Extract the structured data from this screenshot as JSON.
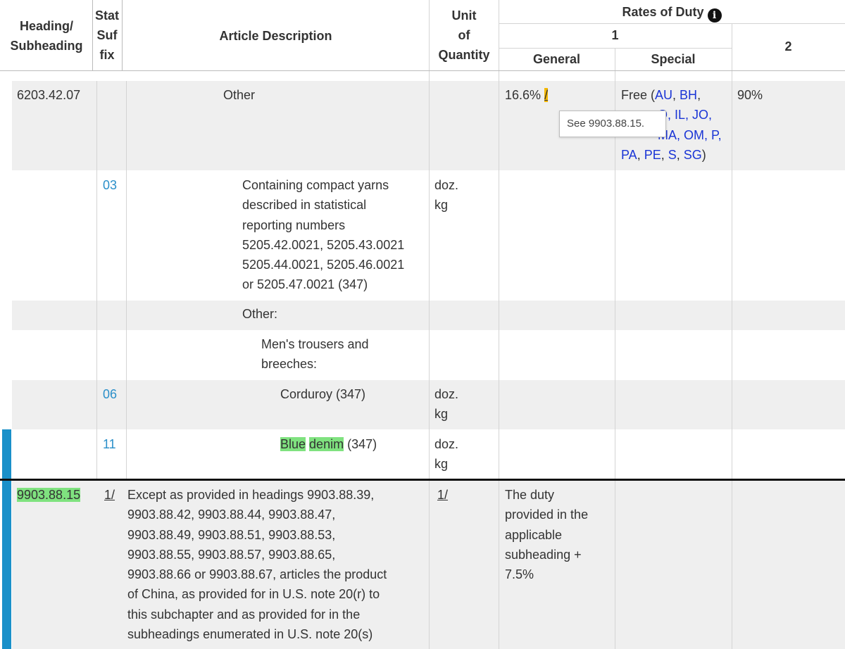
{
  "header": {
    "heading_l1": "Heading/",
    "heading_l2": "Subheading",
    "stat_l1": "Stat",
    "stat_l2": "Suf",
    "stat_l3": "fix",
    "article": "Article Description",
    "unit_l1": "Unit",
    "unit_l2": "of",
    "unit_l3": "Quantity",
    "rates": "Rates of Duty",
    "col1": "1",
    "general": "General",
    "special": "Special",
    "col2": "2",
    "info_icon": "info-icon"
  },
  "rows": {
    "r1": {
      "heading": "6203.42.07",
      "description": "Other",
      "general": "16.6%",
      "footnote": "/",
      "special_prefix": "Free (",
      "special_codes_line1": [
        "AU",
        "BH"
      ],
      "special_line2_visible": "O, IL, JO,",
      "special_line3_visible": "MA, OM, P,",
      "special_codes_line4": [
        "PA",
        "PE",
        "S",
        "SG"
      ],
      "special_suffix": ")",
      "col2": "90%",
      "tooltip": "See 9903.88.15."
    },
    "r2": {
      "stat": "03",
      "desc_lines": [
        "Containing compact yarns",
        "described in statistical",
        "reporting numbers",
        "5205.42.0021, 5205.43.0021",
        "5205.44.0021, 5205.46.0021",
        "or 5205.47.0021 (347)"
      ],
      "unit_lines": [
        "doz.",
        "kg"
      ]
    },
    "r3": {
      "description": "Other:"
    },
    "r4": {
      "desc_lines": [
        "Men's trousers and",
        "breeches:"
      ]
    },
    "r5": {
      "stat": "06",
      "description": "Corduroy (347)",
      "unit_lines": [
        "doz.",
        "kg"
      ]
    },
    "r6": {
      "stat": "11",
      "desc_word1": "Blue",
      "desc_word2": "denim",
      "desc_rest": " (347)",
      "unit_lines": [
        "doz.",
        "kg"
      ]
    },
    "r7": {
      "heading": "9903.88.15",
      "stat": "1/",
      "desc_lines": [
        "Except as provided in headings 9903.88.39,",
        "9903.88.42, 9903.88.44, 9903.88.47,",
        "9903.88.49, 9903.88.51, 9903.88.53,",
        "9903.88.55, 9903.88.57, 9903.88.65,",
        "9903.88.66 or 9903.88.67, articles the product",
        "of China, as provided for in U.S. note 20(r) to",
        "this subchapter and as provided for in the",
        "subheadings enumerated in U.S. note 20(s)"
      ],
      "unit": "1/",
      "general_lines": [
        "The duty",
        "provided in the",
        "applicable",
        "subheading +",
        "7.5%"
      ]
    }
  },
  "colors": {
    "stat_blue": "#2a8fc9",
    "link_blue": "#1a35d6",
    "highlight_green": "#7fe27f",
    "footnote_orange": "#f5b800",
    "row_gray": "#efefef",
    "marker_blue": "#1a90c9"
  }
}
